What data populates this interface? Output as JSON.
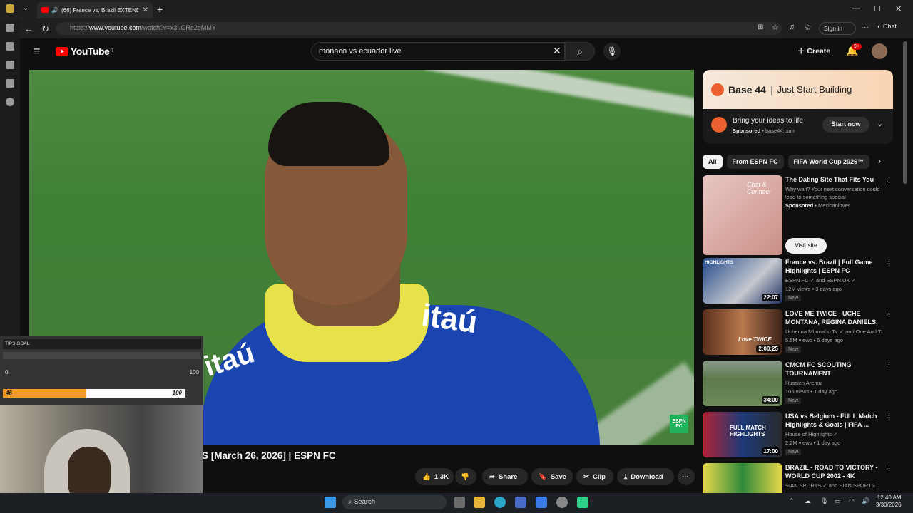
{
  "browser": {
    "tab_title": "(66) France vs. Brazil EXTENDE",
    "new_tab_glyph": "+",
    "url_prefix": "https://",
    "url_domain": "www.youtube.com",
    "url_path": "/watch?v=x3uGRe2gMMY",
    "sign_in": "Sign in",
    "chat": "Chat"
  },
  "youtube": {
    "logo_text": "YouTube",
    "country": "IT",
    "search_value": "monaco vs ecuador live",
    "create_label": "Create",
    "notif_badge": "9+"
  },
  "video": {
    "title_visible": "S [March 26, 2026] | ESPN FC",
    "jersey_text": "itaú",
    "espn_logo": "ESPN FC",
    "actions": {
      "likes": "1.3K",
      "share": "Share",
      "save": "Save",
      "clip": "Clip",
      "download": "Download"
    }
  },
  "overlay": {
    "tips_label": "TIPS GOAL",
    "range_min": "0",
    "range_max": "100",
    "progress_left": "46",
    "progress_right": "100",
    "progress_fraction": 0.46,
    "accent": "#f29b24"
  },
  "ad": {
    "brand": "Base 44",
    "tagline": "Just Start Building",
    "title": "Bring your ideas to life",
    "sponsored": "Sponsored",
    "domain": "base44.com",
    "cta": "Start now"
  },
  "chips": [
    "All",
    "From ESPN FC",
    "FIFA World Cup 2026™"
  ],
  "recs": [
    {
      "title": "The Dating Site That Fits You",
      "desc": "Why wait? Your next conversation could lead to something special",
      "sponsored": "Sponsored",
      "advertiser": "Mexicanloves",
      "cta": "Visit site",
      "thumb_text": "Chat & Connect"
    },
    {
      "title": "France vs. Brazil | Full Game Highlights | ESPN FC",
      "channel": "ESPN FC ✓ and ESPN UK ✓",
      "views": "12M views • 3 days ago",
      "badge": "New",
      "duration": "22:07",
      "thumb_text": "HIGHLIGHTS"
    },
    {
      "title": "LOVE ME TWICE - UCHE MONTANA, REGINA DANIELS, ...",
      "channel": "Uchenna Mbunabo Tv ✓ and One And T...",
      "views": "5.5M views • 6 days ago",
      "badge": "New",
      "duration": "2:00:25",
      "thumb_text": "Love TWICE"
    },
    {
      "title": "CMCM FC SCOUTING TOURNAMENT",
      "channel": "Hussien Aremu",
      "views": "105 views • 1 day ago",
      "badge": "New",
      "duration": "34:00"
    },
    {
      "title": "USA vs Belgium - FULL Match Highlights & Goals | FIFA ...",
      "channel": "House of Highlights ✓",
      "views": "2.2M views • 1 day ago",
      "badge": "New",
      "duration": "17:00",
      "thumb_text": "FULL MATCH HIGHLIGHTS"
    },
    {
      "title": "BRAZIL - ROAD TO VICTORY - WORLD CUP 2002 - 4K",
      "channel": "SIAN SPORTS ✓ and SIAN SPORTS"
    }
  ],
  "taskbar": {
    "search": "Search",
    "time": "12:40 AM",
    "date": "3/30/2026"
  }
}
